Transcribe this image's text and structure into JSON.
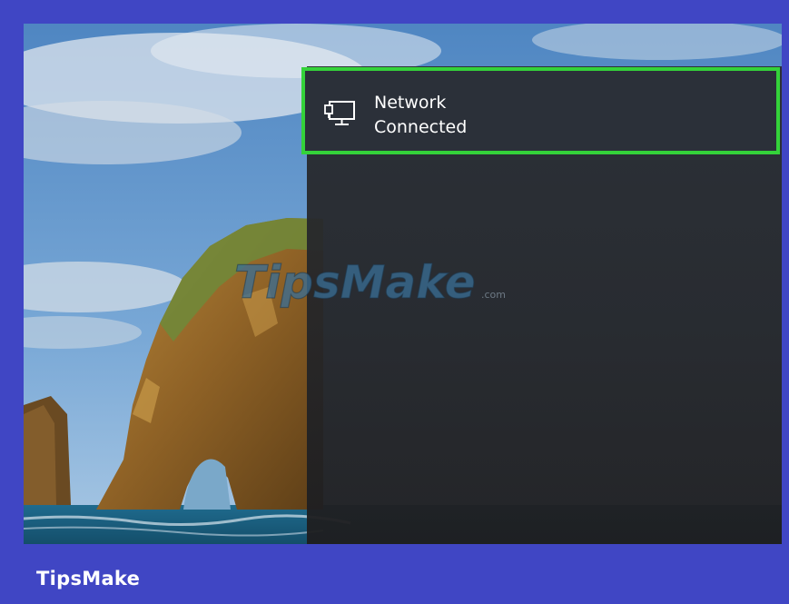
{
  "network_tile": {
    "title": "Network",
    "status": "Connected",
    "icon": "wired-network-icon",
    "highlight_color": "#34d23a"
  },
  "watermark": {
    "brand": "TipsMake",
    "suffix": ".com"
  },
  "footer": {
    "brand": "TipsMake",
    "background_color": "#4046c4"
  }
}
